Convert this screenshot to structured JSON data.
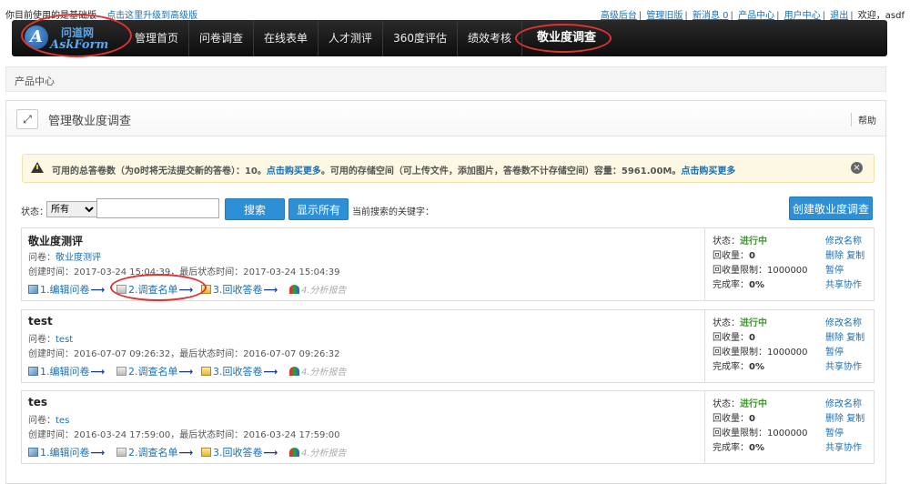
{
  "topbar": {
    "left_text": "你目前使用的是基础版",
    "upgrade_link": "点击这里升级到高级版",
    "links": [
      "高级后台",
      "管理旧版",
      "新消息 0",
      "产品中心",
      "用户中心",
      "退出"
    ],
    "welcome": "欢迎，asdf"
  },
  "logo": {
    "cn": "问道网",
    "en": "AskForm",
    "mark": "A"
  },
  "nav": {
    "items": [
      "管理首页",
      "问卷调查",
      "在线表单",
      "人才测评",
      "360度评估",
      "绩效考核"
    ],
    "active": "敬业度调查"
  },
  "breadcrumb": "产品中心",
  "panel": {
    "title": "管理敬业度调查",
    "help": "帮助",
    "expand_icon": "⤢"
  },
  "notice": {
    "t1": "可用的总答卷数（为0时将无法提交新的答卷）：10。",
    "link1": "点击购买更多",
    "t2": "。可用的存储空间（可上传文件，添加图片，答卷数不计存储空间）容量：5961.00M。",
    "link2": "点击购买更多",
    "close": "×"
  },
  "toolbar": {
    "status_label": "状态：",
    "status_value": "所有",
    "search_label": "搜索",
    "show_all_label": "显示所有",
    "keyword_label": "当前搜索的关键字：",
    "create_label": "创建敬业度调查"
  },
  "labels": {
    "q_prefix": "问卷：",
    "created": "创建时间：",
    "last_status": "，最后状态时间：",
    "status": "状态：",
    "collected": "回收量：",
    "limit": "回收量限制：",
    "completion": "完成率：",
    "step1": "1.编辑问卷",
    "step2": "2.调查名单",
    "step3": "3.回收答卷",
    "step4": "4.分析报告",
    "arrow": "⟶",
    "rename": "修改名称",
    "delete": "删除",
    "copy": "复制",
    "pause": "暂停",
    "share": "共享协作"
  },
  "surveys": [
    {
      "title": "敬业度测评",
      "questionnaire": "敬业度测评",
      "created": "2017-03-24 15:04:39",
      "last": "2017-03-24 15:04:39",
      "status": "进行中",
      "collected": "0",
      "limit": "1000000",
      "completion": "0%"
    },
    {
      "title": "test",
      "questionnaire": "test",
      "created": "2016-07-07 09:26:32",
      "last": "2016-07-07 09:26:32",
      "status": "进行中",
      "collected": "0",
      "limit": "1000000",
      "completion": "0%"
    },
    {
      "title": "tes",
      "questionnaire": "tes",
      "created": "2016-03-24 17:59:00",
      "last": "2016-03-24 17:59:00",
      "status": "进行中",
      "collected": "0",
      "limit": "1000000",
      "completion": "0%"
    }
  ],
  "colors": {
    "nav_bg": "#111111",
    "accent_blue": "#2d8fd5",
    "link": "#1a6fb5",
    "annotation_red": "#e0322f",
    "status_green": "#3a9a2a",
    "notice_bg": "#fcf8e3"
  }
}
